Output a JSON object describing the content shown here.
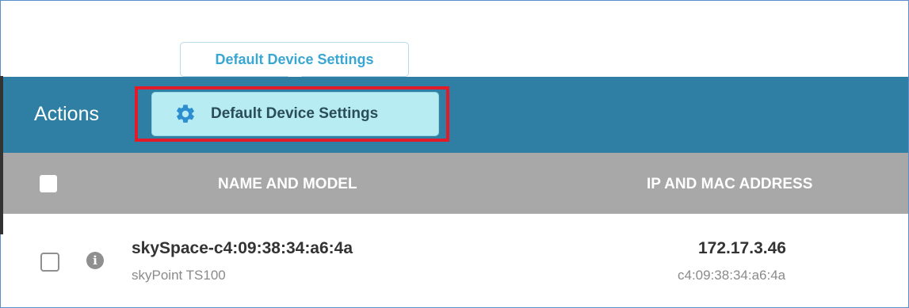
{
  "tooltip": {
    "text": "Default Device Settings"
  },
  "actions_bar": {
    "label": "Actions",
    "default_settings_button": {
      "label": "Default Device Settings",
      "icon": "gear-icon"
    },
    "highlight_color": "#e21b2b",
    "bar_color": "#2e7fa3"
  },
  "table": {
    "columns": [
      "NAME AND MODEL",
      "IP AND MAC ADDRESS"
    ],
    "rows": [
      {
        "name": "skySpace-c4:09:38:34:a6:4a",
        "model": "skyPoint TS100",
        "ip": "172.17.3.46",
        "mac": "c4:09:38:34:a6:4a",
        "info_icon": "info-icon"
      }
    ]
  }
}
